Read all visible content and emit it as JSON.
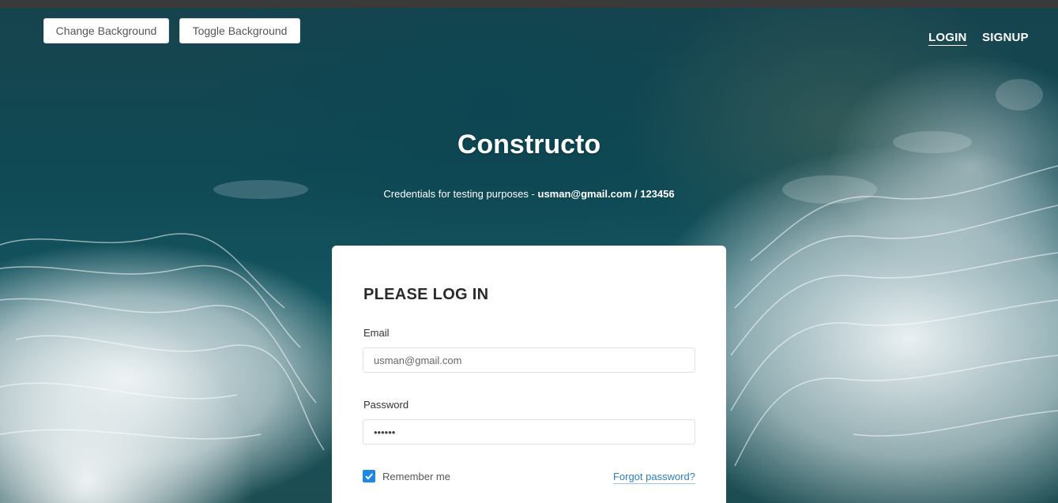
{
  "header": {
    "change_background_label": "Change Background",
    "toggle_background_label": "Toggle Background",
    "nav": {
      "login": "LOGIN",
      "signup": "SIGNUP",
      "active": "login"
    }
  },
  "hero": {
    "brand": "Constructo",
    "credentials_prefix": "Credentials for testing purposes - ",
    "credentials_value": "usman@gmail.com / 123456"
  },
  "login_form": {
    "title": "PLEASE LOG IN",
    "email_label": "Email",
    "email_value": "usman@gmail.com",
    "password_label": "Password",
    "password_value": "123456",
    "remember_label": "Remember me",
    "remember_checked": true,
    "forgot_label": "Forgot password?"
  },
  "colors": {
    "accent": "#1e88e5",
    "link": "#2d7fc1",
    "topbar": "#3a3a3a"
  },
  "icons": {
    "checkbox": "check-icon"
  }
}
